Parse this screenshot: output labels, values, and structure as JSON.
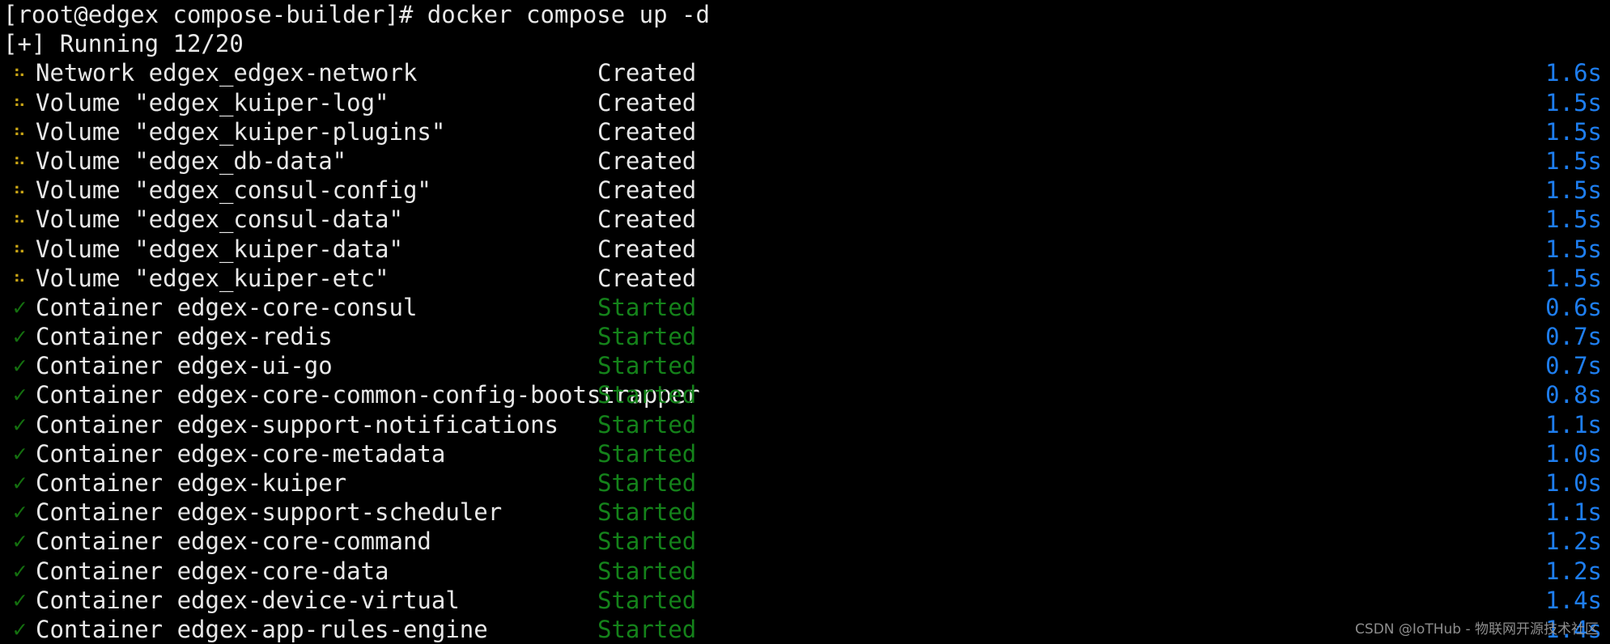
{
  "terminal": {
    "prompt_line": "[root@edgex compose-builder]# docker compose up -d",
    "status_line": "[+] Running 12/20",
    "colors": {
      "background": "#000000",
      "default_text": "#e8e8e8",
      "spinner_dots": "#c8a415",
      "check_mark": "#14700f",
      "started_green": "#14821a",
      "time_blue": "#1e7ef0",
      "watermark_gray": "#9a9a9a"
    },
    "markers": {
      "pending": "⠦",
      "done": "✓"
    },
    "services": [
      {
        "marker": "pending",
        "name": "Network edgex_edgex-network",
        "status": "Created",
        "status_kind": "created",
        "time": "1.6s"
      },
      {
        "marker": "pending",
        "name": "Volume \"edgex_kuiper-log\"",
        "status": "Created",
        "status_kind": "created",
        "time": "1.5s"
      },
      {
        "marker": "pending",
        "name": "Volume \"edgex_kuiper-plugins\"",
        "status": "Created",
        "status_kind": "created",
        "time": "1.5s"
      },
      {
        "marker": "pending",
        "name": "Volume \"edgex_db-data\"",
        "status": "Created",
        "status_kind": "created",
        "time": "1.5s"
      },
      {
        "marker": "pending",
        "name": "Volume \"edgex_consul-config\"",
        "status": "Created",
        "status_kind": "created",
        "time": "1.5s"
      },
      {
        "marker": "pending",
        "name": "Volume \"edgex_consul-data\"",
        "status": "Created",
        "status_kind": "created",
        "time": "1.5s"
      },
      {
        "marker": "pending",
        "name": "Volume \"edgex_kuiper-data\"",
        "status": "Created",
        "status_kind": "created",
        "time": "1.5s"
      },
      {
        "marker": "pending",
        "name": "Volume \"edgex_kuiper-etc\"",
        "status": "Created",
        "status_kind": "created",
        "time": "1.5s"
      },
      {
        "marker": "done",
        "name": "Container edgex-core-consul",
        "status": "Started",
        "status_kind": "started",
        "time": "0.6s"
      },
      {
        "marker": "done",
        "name": "Container edgex-redis",
        "status": "Started",
        "status_kind": "started",
        "time": "0.7s"
      },
      {
        "marker": "done",
        "name": "Container edgex-ui-go",
        "status": "Started",
        "status_kind": "started",
        "time": "0.7s"
      },
      {
        "marker": "done",
        "name": "Container edgex-core-common-config-bootstrapper",
        "status": "Started",
        "status_kind": "started",
        "time": "0.8s"
      },
      {
        "marker": "done",
        "name": "Container edgex-support-notifications",
        "status": "Started",
        "status_kind": "started",
        "time": "1.1s"
      },
      {
        "marker": "done",
        "name": "Container edgex-core-metadata",
        "status": "Started",
        "status_kind": "started",
        "time": "1.0s"
      },
      {
        "marker": "done",
        "name": "Container edgex-kuiper",
        "status": "Started",
        "status_kind": "started",
        "time": "1.0s"
      },
      {
        "marker": "done",
        "name": "Container edgex-support-scheduler",
        "status": "Started",
        "status_kind": "started",
        "time": "1.1s"
      },
      {
        "marker": "done",
        "name": "Container edgex-core-command",
        "status": "Started",
        "status_kind": "started",
        "time": "1.2s"
      },
      {
        "marker": "done",
        "name": "Container edgex-core-data",
        "status": "Started",
        "status_kind": "started",
        "time": "1.2s"
      },
      {
        "marker": "done",
        "name": "Container edgex-device-virtual",
        "status": "Started",
        "status_kind": "started",
        "time": "1.4s"
      },
      {
        "marker": "done",
        "name": "Container edgex-app-rules-engine",
        "status": "Started",
        "status_kind": "started",
        "time": "1.4s"
      }
    ]
  },
  "watermark": {
    "text": "CSDN @IoTHub - 物联网开源技术社区"
  }
}
